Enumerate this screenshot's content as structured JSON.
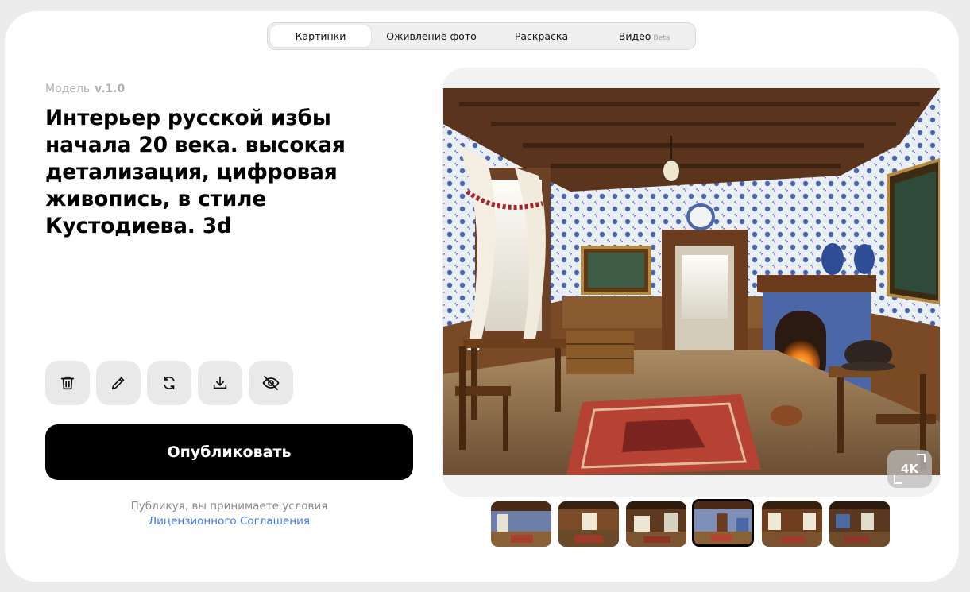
{
  "tabs": [
    {
      "label": "Картинки",
      "active": true
    },
    {
      "label": "Оживление фото",
      "active": false
    },
    {
      "label": "Раскраска",
      "active": false
    },
    {
      "label": "Видео",
      "badge": "Beta",
      "active": false
    }
  ],
  "model": {
    "label": "Модель",
    "version": "v.1.0"
  },
  "prompt": "Интерьер русской избы начала 20 века. высокая детализация, цифровая живопись, в стиле Кустодиева. 3d",
  "tools": [
    {
      "name": "delete",
      "icon": "trash-icon"
    },
    {
      "name": "edit",
      "icon": "pencil-icon"
    },
    {
      "name": "regenerate",
      "icon": "refresh-icon"
    },
    {
      "name": "download",
      "icon": "download-icon"
    },
    {
      "name": "hide",
      "icon": "eye-off-icon"
    }
  ],
  "publish_label": "Опубликовать",
  "terms": {
    "text": "Публикуя, вы принимаете условия",
    "link": "Лицензионного Соглашения"
  },
  "upscale_label": "4K",
  "thumbnails": {
    "count": 6,
    "selected_index": 3
  },
  "colors": {
    "primary": "#000000",
    "link": "#3b7df0",
    "muted": "#b0b0b0"
  }
}
